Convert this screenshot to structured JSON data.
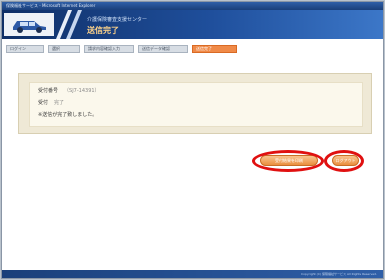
{
  "window": {
    "title": "保険福祉サービス - Microsoft Internet Explorer"
  },
  "header": {
    "system_name": "介護保険審査支援センター",
    "status_title": "送信完了"
  },
  "tabs": [
    {
      "label": "ログイン"
    },
    {
      "label": "選択"
    },
    {
      "label": "請求内容確認入力"
    },
    {
      "label": "送信データ確認"
    },
    {
      "label": "送信完了"
    }
  ],
  "result": {
    "fields": [
      {
        "label": "受付番号",
        "value": "（SJ7-14391）"
      },
      {
        "label": "受付",
        "value": "完了"
      }
    ],
    "message": "※送信が完了致しました。"
  },
  "actions": {
    "print_label": "受付結果を印刷",
    "logout_label": "ログアウト"
  },
  "footer": {
    "text": "Copyright (C) 保険福祉サービス All Rights Reserved."
  }
}
